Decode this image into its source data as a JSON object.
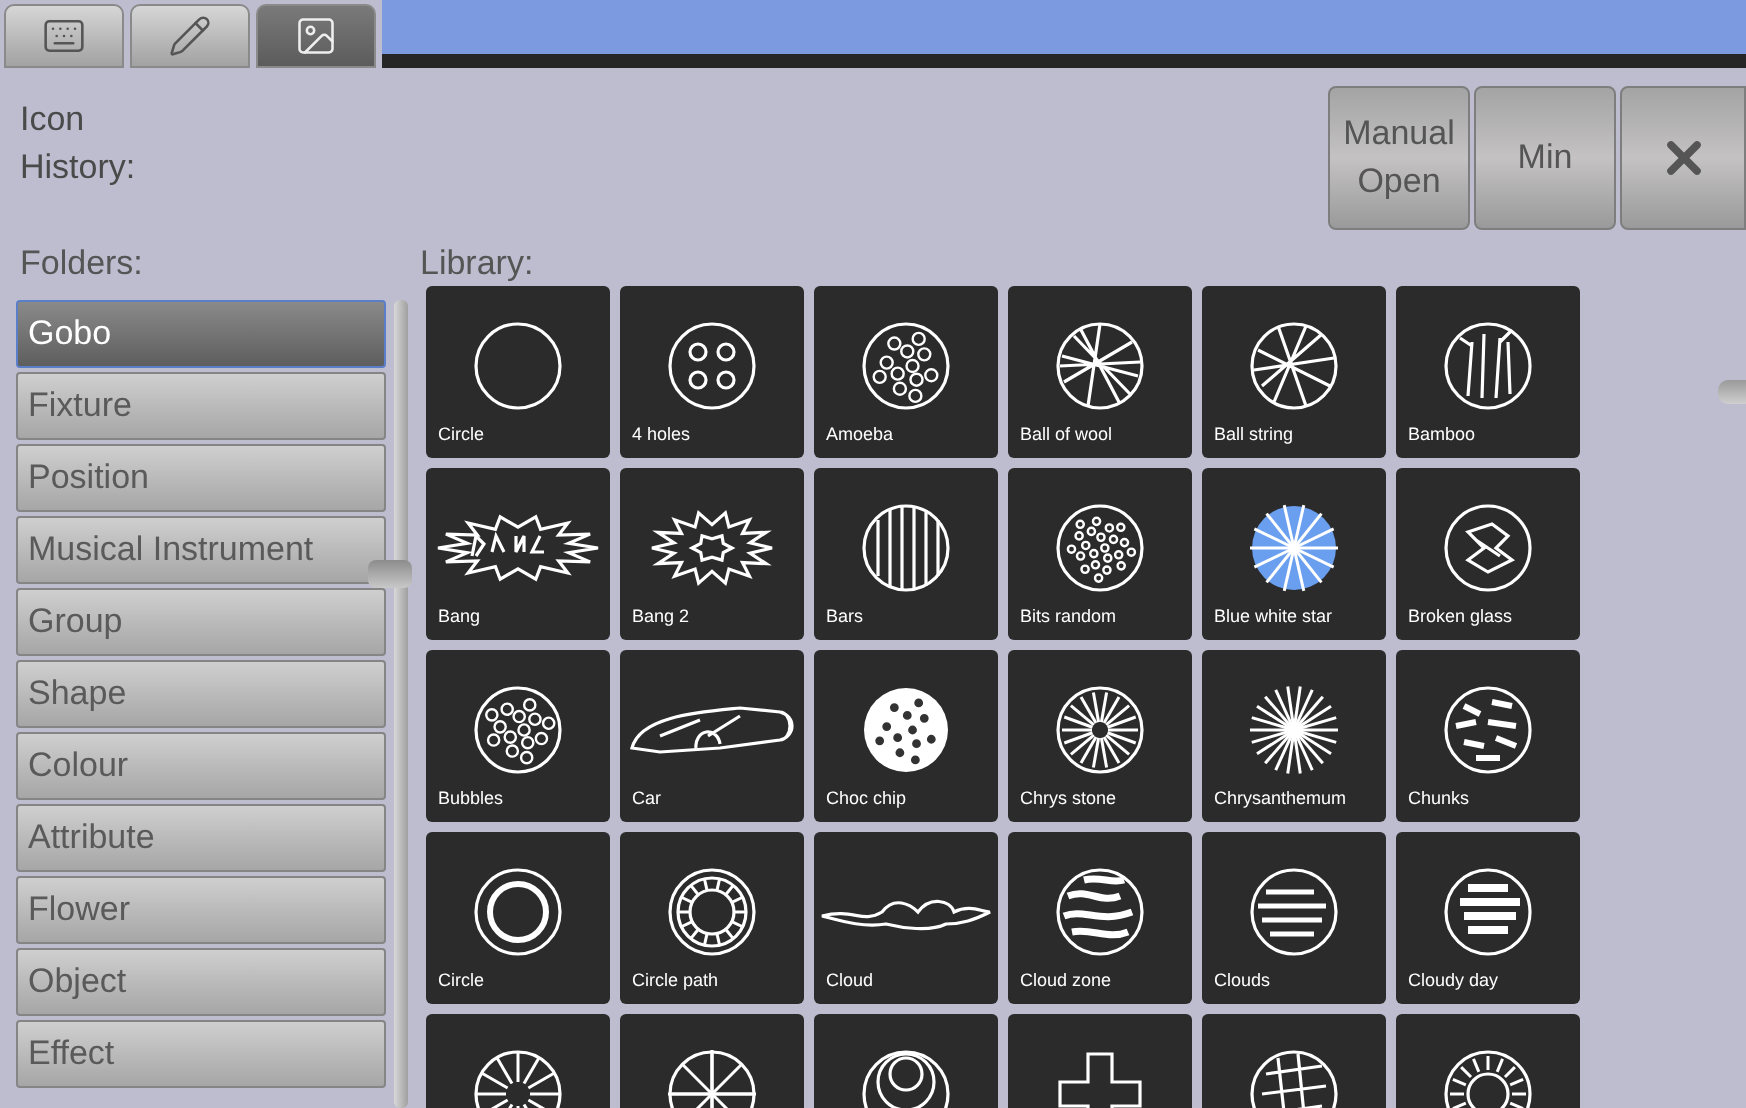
{
  "tabs": [
    {
      "selected": false
    },
    {
      "selected": false
    },
    {
      "selected": true
    }
  ],
  "history_label": "Icon History:",
  "buttons": [
    "Manual Open",
    "Min"
  ],
  "folders_label": "Folders:",
  "folders": [
    {
      "label": "Gobo",
      "selected": true
    },
    {
      "label": "Fixture",
      "selected": false
    },
    {
      "label": "Position",
      "selected": false
    },
    {
      "label": "Musical Instrument",
      "selected": false
    },
    {
      "label": "Group",
      "selected": false
    },
    {
      "label": "Shape",
      "selected": false
    },
    {
      "label": "Colour",
      "selected": false
    },
    {
      "label": "Attribute",
      "selected": false
    },
    {
      "label": "Flower",
      "selected": false
    },
    {
      "label": "Object",
      "selected": false
    },
    {
      "label": "Effect",
      "selected": false
    }
  ],
  "library_label": "Library:",
  "library": [
    {
      "label": "Circle",
      "selected": false
    },
    {
      "label": "4 holes",
      "selected": false
    },
    {
      "label": "Amoeba",
      "selected": false
    },
    {
      "label": "Ball of wool",
      "selected": false
    },
    {
      "label": "Ball string",
      "selected": false
    },
    {
      "label": "Bamboo",
      "selected": false
    },
    {
      "label": "Bang",
      "selected": false
    },
    {
      "label": "Bang 2",
      "selected": false
    },
    {
      "label": "Bars",
      "selected": false
    },
    {
      "label": "Bits random",
      "selected": false
    },
    {
      "label": "Blue white star",
      "selected": false
    },
    {
      "label": "Broken glass",
      "selected": false
    },
    {
      "label": "Bubbles",
      "selected": false
    },
    {
      "label": "Car",
      "selected": false
    },
    {
      "label": "Choc chip",
      "selected": false
    },
    {
      "label": "Chrys stone",
      "selected": false
    },
    {
      "label": "Chrysanthemum",
      "selected": false
    },
    {
      "label": "Chunks",
      "selected": false
    },
    {
      "label": "Circle",
      "selected": false
    },
    {
      "label": "Circle path",
      "selected": false
    },
    {
      "label": "Cloud",
      "selected": false
    },
    {
      "label": "Cloud zone",
      "selected": false
    },
    {
      "label": "Clouds",
      "selected": false
    },
    {
      "label": "Cloudy day",
      "selected": false
    },
    {
      "selected": false
    },
    {
      "selected": false
    },
    {
      "selected": false
    },
    {
      "selected": false
    },
    {
      "selected": false
    },
    {
      "selected": false
    }
  ]
}
